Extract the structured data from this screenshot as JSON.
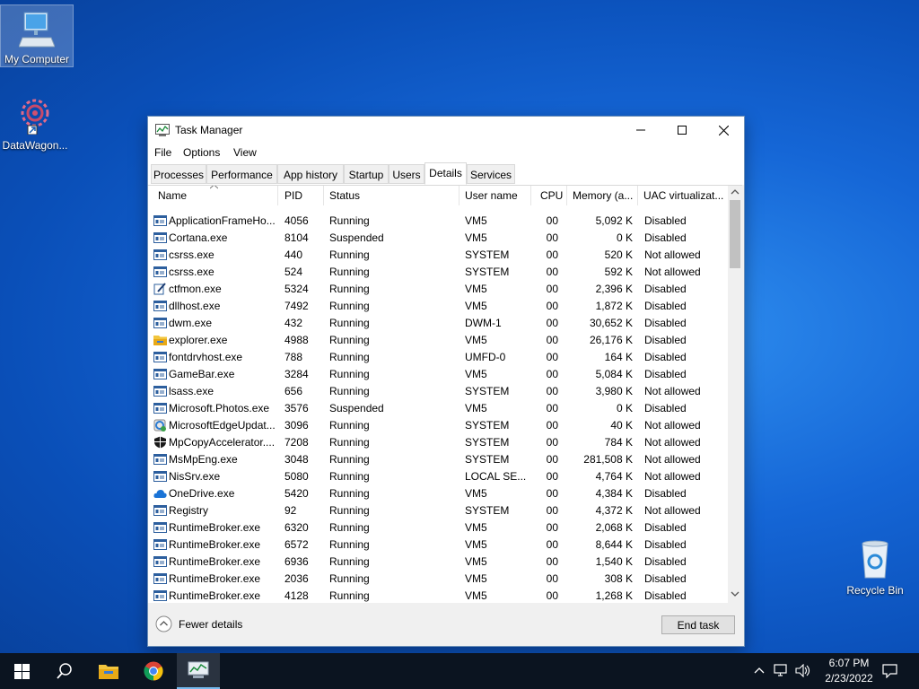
{
  "desktop": {
    "icons": [
      {
        "label": "My Computer",
        "icon": "computer-icon"
      },
      {
        "label": "DataWagon...",
        "icon": "datawagon-icon"
      },
      {
        "label": "Recycle Bin",
        "icon": "recycle-bin-icon"
      }
    ]
  },
  "window": {
    "title": "Task Manager",
    "menu": [
      "File",
      "Options",
      "View"
    ],
    "tabs": [
      "Processes",
      "Performance",
      "App history",
      "Startup",
      "Users",
      "Details",
      "Services"
    ],
    "active_tab": "Details",
    "columns": [
      "Name",
      "PID",
      "Status",
      "User name",
      "CPU",
      "Memory (a...",
      "UAC virtualizat..."
    ],
    "processes": [
      {
        "name": "ApplicationFrameHo...",
        "pid": "4056",
        "status": "Running",
        "user": "VM5",
        "cpu": "00",
        "mem": "5,092 K",
        "uac": "Disabled",
        "icon": "app-icon"
      },
      {
        "name": "Cortana.exe",
        "pid": "8104",
        "status": "Suspended",
        "user": "VM5",
        "cpu": "00",
        "mem": "0 K",
        "uac": "Disabled",
        "icon": "app-icon"
      },
      {
        "name": "csrss.exe",
        "pid": "440",
        "status": "Running",
        "user": "SYSTEM",
        "cpu": "00",
        "mem": "520 K",
        "uac": "Not allowed",
        "icon": "app-icon"
      },
      {
        "name": "csrss.exe",
        "pid": "524",
        "status": "Running",
        "user": "SYSTEM",
        "cpu": "00",
        "mem": "592 K",
        "uac": "Not allowed",
        "icon": "app-icon"
      },
      {
        "name": "ctfmon.exe",
        "pid": "5324",
        "status": "Running",
        "user": "VM5",
        "cpu": "00",
        "mem": "2,396 K",
        "uac": "Disabled",
        "icon": "pen-icon"
      },
      {
        "name": "dllhost.exe",
        "pid": "7492",
        "status": "Running",
        "user": "VM5",
        "cpu": "00",
        "mem": "1,872 K",
        "uac": "Disabled",
        "icon": "app-icon"
      },
      {
        "name": "dwm.exe",
        "pid": "432",
        "status": "Running",
        "user": "DWM-1",
        "cpu": "00",
        "mem": "30,652 K",
        "uac": "Disabled",
        "icon": "app-icon"
      },
      {
        "name": "explorer.exe",
        "pid": "4988",
        "status": "Running",
        "user": "VM5",
        "cpu": "00",
        "mem": "26,176 K",
        "uac": "Disabled",
        "icon": "folder-icon"
      },
      {
        "name": "fontdrvhost.exe",
        "pid": "788",
        "status": "Running",
        "user": "UMFD-0",
        "cpu": "00",
        "mem": "164 K",
        "uac": "Disabled",
        "icon": "app-icon"
      },
      {
        "name": "GameBar.exe",
        "pid": "3284",
        "status": "Running",
        "user": "VM5",
        "cpu": "00",
        "mem": "5,084 K",
        "uac": "Disabled",
        "icon": "app-icon"
      },
      {
        "name": "lsass.exe",
        "pid": "656",
        "status": "Running",
        "user": "SYSTEM",
        "cpu": "00",
        "mem": "3,980 K",
        "uac": "Not allowed",
        "icon": "app-icon"
      },
      {
        "name": "Microsoft.Photos.exe",
        "pid": "3576",
        "status": "Suspended",
        "user": "VM5",
        "cpu": "00",
        "mem": "0 K",
        "uac": "Disabled",
        "icon": "app-icon"
      },
      {
        "name": "MicrosoftEdgeUpdat...",
        "pid": "3096",
        "status": "Running",
        "user": "SYSTEM",
        "cpu": "00",
        "mem": "40 K",
        "uac": "Not allowed",
        "icon": "edge-update-icon"
      },
      {
        "name": "MpCopyAccelerator....",
        "pid": "7208",
        "status": "Running",
        "user": "SYSTEM",
        "cpu": "00",
        "mem": "784 K",
        "uac": "Not allowed",
        "icon": "shield-icon"
      },
      {
        "name": "MsMpEng.exe",
        "pid": "3048",
        "status": "Running",
        "user": "SYSTEM",
        "cpu": "00",
        "mem": "281,508 K",
        "uac": "Not allowed",
        "icon": "app-icon"
      },
      {
        "name": "NisSrv.exe",
        "pid": "5080",
        "status": "Running",
        "user": "LOCAL SE...",
        "cpu": "00",
        "mem": "4,764 K",
        "uac": "Not allowed",
        "icon": "app-icon"
      },
      {
        "name": "OneDrive.exe",
        "pid": "5420",
        "status": "Running",
        "user": "VM5",
        "cpu": "00",
        "mem": "4,384 K",
        "uac": "Disabled",
        "icon": "cloud-icon"
      },
      {
        "name": "Registry",
        "pid": "92",
        "status": "Running",
        "user": "SYSTEM",
        "cpu": "00",
        "mem": "4,372 K",
        "uac": "Not allowed",
        "icon": "app-icon"
      },
      {
        "name": "RuntimeBroker.exe",
        "pid": "6320",
        "status": "Running",
        "user": "VM5",
        "cpu": "00",
        "mem": "2,068 K",
        "uac": "Disabled",
        "icon": "app-icon"
      },
      {
        "name": "RuntimeBroker.exe",
        "pid": "6572",
        "status": "Running",
        "user": "VM5",
        "cpu": "00",
        "mem": "8,644 K",
        "uac": "Disabled",
        "icon": "app-icon"
      },
      {
        "name": "RuntimeBroker.exe",
        "pid": "6936",
        "status": "Running",
        "user": "VM5",
        "cpu": "00",
        "mem": "1,540 K",
        "uac": "Disabled",
        "icon": "app-icon"
      },
      {
        "name": "RuntimeBroker.exe",
        "pid": "2036",
        "status": "Running",
        "user": "VM5",
        "cpu": "00",
        "mem": "308 K",
        "uac": "Disabled",
        "icon": "app-icon"
      },
      {
        "name": "RuntimeBroker.exe",
        "pid": "4128",
        "status": "Running",
        "user": "VM5",
        "cpu": "00",
        "mem": "1,268 K",
        "uac": "Disabled",
        "icon": "app-icon"
      }
    ],
    "footer": {
      "fewer_details": "Fewer details",
      "end_task": "End task"
    }
  },
  "taskbar": {
    "time": "6:07 PM",
    "date": "2/23/2022",
    "pinned": [
      "start-icon",
      "search-icon",
      "file-explorer-icon",
      "chrome-icon",
      "task-manager-icon"
    ]
  },
  "colors": {
    "accent": "#0078d7",
    "taskbar": "#0b1420"
  }
}
